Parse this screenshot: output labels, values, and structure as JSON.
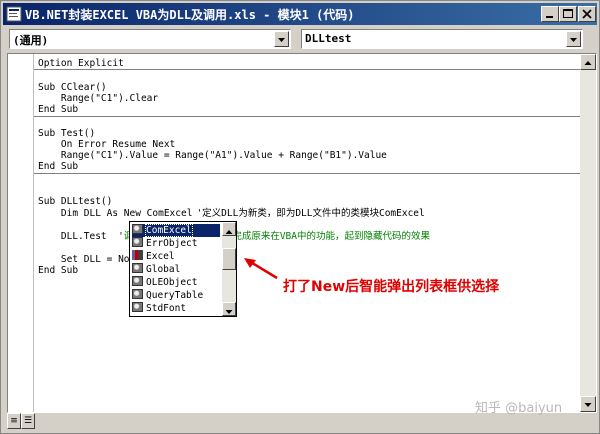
{
  "window": {
    "title": "VB.NET封装EXCEL VBA为DLL及调用.xls - 模块1 (代码)"
  },
  "toolbar": {
    "object_combo": "(通用)",
    "proc_combo": "DLLtest"
  },
  "code": {
    "l1": "Option Explicit",
    "l2": "Sub CClear()",
    "l3": "    Range(\"C1\").Clear",
    "l4": "End Sub",
    "l5": "Sub Test()",
    "l6": "    On Error Resume Next",
    "l7": "    Range(\"C1\").Value = Range(\"A1\").Value + Range(\"B1\").Value",
    "l8": "End Sub",
    "l9": "Sub DLLtest()",
    "l10a": "    Dim DLL As New ",
    "l10b": "ComExcel",
    "l10c": "'定义DLL为新类，即为DLL文件中的类模块ComExcel",
    "l11a": "    DLL.Test  '",
    "l11b": "调",
    "l11c": "，来完成原来在VBA中的功能，起到隐藏代码的效果",
    "l12": "    Set DLL = No",
    "l13": "End Sub"
  },
  "popup": {
    "items": [
      "ComExcel",
      "ErrObject",
      "Excel",
      "Global",
      "OLEObject",
      "QueryTable",
      "StdFont"
    ]
  },
  "annotation": "打了New后智能弹出列表框供选择",
  "watermark": "知乎 @baiyun",
  "colors": {
    "title_start": "#0a246a",
    "title_end": "#3a6ea5",
    "comment": "#008000",
    "annotation": "#e00000",
    "selection": "#0a246a"
  },
  "icons": [
    "vba-module-icon",
    "minimize-icon",
    "maximize-icon",
    "close-icon",
    "dropdown-arrow-icon",
    "class-icon",
    "library-icon",
    "red-arrow-icon"
  ]
}
